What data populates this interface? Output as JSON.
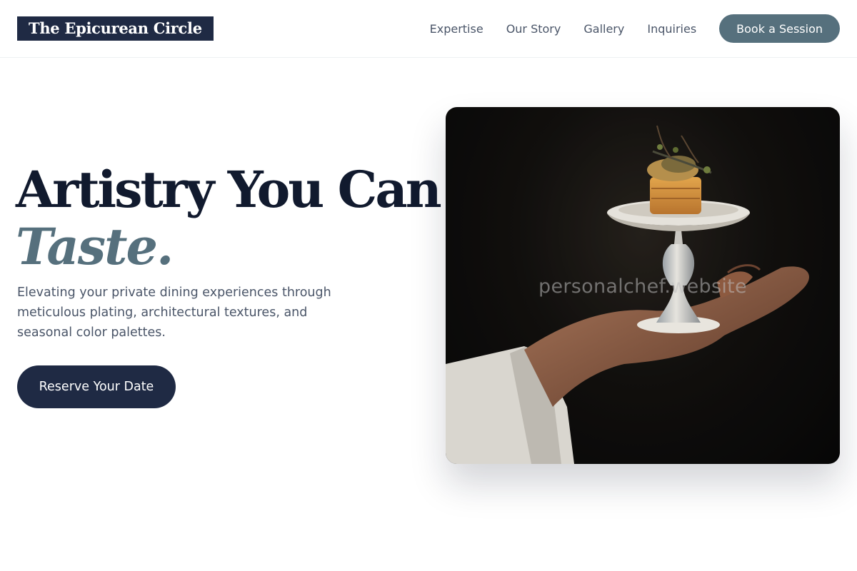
{
  "brand": {
    "name": "The Epicurean Circle"
  },
  "nav": {
    "links": [
      "Expertise",
      "Our Story",
      "Gallery",
      "Inquiries"
    ],
    "cta_label": "Book a Session"
  },
  "hero": {
    "title_line1": "Artistry You Can",
    "title_line2": "Taste.",
    "description": "Elevating your private dining experiences through meticulous plating, architectural textures, and seasonal color palettes.",
    "button_label": "Reserve Your Date",
    "image_watermark": "personalchef.website"
  },
  "colors": {
    "navy": "#1f2a44",
    "slate_accent": "#56707d",
    "body_text": "#4a5568"
  }
}
